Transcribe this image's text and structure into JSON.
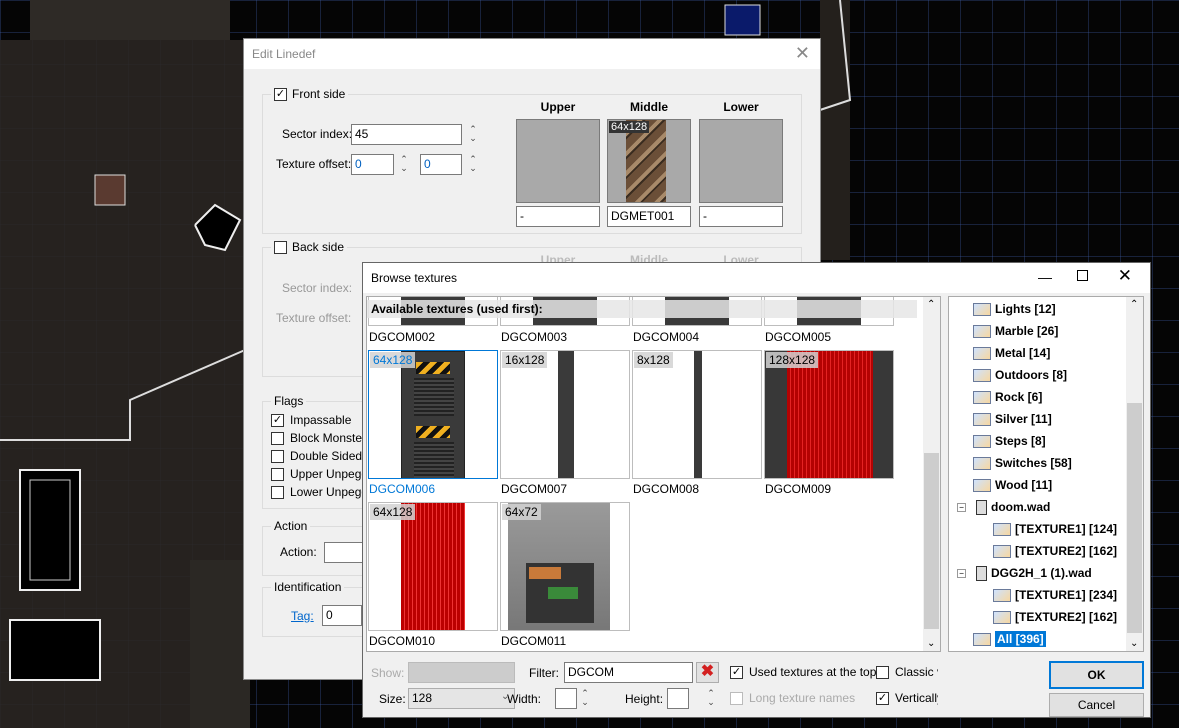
{
  "edit_linedef": {
    "title": "Edit Linedef",
    "front": {
      "label": "Front side",
      "checked": true,
      "sector_label": "Sector index:",
      "sector": "45",
      "offset_label": "Texture offset:",
      "offset_x": "0",
      "offset_y": "0",
      "upper": "Upper",
      "middle": "Middle",
      "lower": "Lower",
      "upper_tex": "-",
      "middle_tex": "DGMET001",
      "lower_tex": "-",
      "middle_size": "64x128"
    },
    "back": {
      "label": "Back side",
      "checked": false,
      "upper": "Upper",
      "middle": "Middle",
      "lower": "Lower",
      "sector_label": "Sector index:",
      "offset_label": "Texture offset:"
    },
    "flags": {
      "label": "Flags",
      "items": [
        {
          "label": "Impassable",
          "checked": true
        },
        {
          "label": "Block Monsters",
          "checked": false
        },
        {
          "label": "Double Sided",
          "checked": false
        },
        {
          "label": "Upper Unpegge",
          "checked": false
        },
        {
          "label": "Lower Unpegge",
          "checked": false
        }
      ]
    },
    "action": {
      "group": "Action",
      "label": "Action:",
      "value": ""
    },
    "identification": {
      "group": "Identification",
      "tag_label": "Tag:",
      "tag": "0"
    }
  },
  "browse": {
    "title": "Browse textures",
    "section_header": "Available textures (used first):",
    "top_row": [
      "DGCOM002",
      "DGCOM003",
      "DGCOM004",
      "DGCOM005"
    ],
    "textures": [
      {
        "name": "DGCOM006",
        "size": "64x128",
        "selected": true
      },
      {
        "name": "DGCOM007",
        "size": "16x128"
      },
      {
        "name": "DGCOM008",
        "size": "8x128"
      },
      {
        "name": "DGCOM009",
        "size": "128x128"
      },
      {
        "name": "DGCOM010",
        "size": "64x128"
      },
      {
        "name": "DGCOM011",
        "size": "64x72"
      }
    ],
    "tree": [
      {
        "label": "Lights [12]",
        "level": 1
      },
      {
        "label": "Marble [26]",
        "level": 1
      },
      {
        "label": "Metal [14]",
        "level": 1
      },
      {
        "label": "Outdoors [8]",
        "level": 1
      },
      {
        "label": "Rock [6]",
        "level": 1
      },
      {
        "label": "Silver [11]",
        "level": 1
      },
      {
        "label": "Steps [8]",
        "level": 1
      },
      {
        "label": "Switches [58]",
        "level": 1
      },
      {
        "label": "Wood [11]",
        "level": 1
      },
      {
        "label": "doom.wad",
        "level": 0,
        "wad": true
      },
      {
        "label": "[TEXTURE1] [124]",
        "level": 2
      },
      {
        "label": "[TEXTURE2] [162]",
        "level": 2
      },
      {
        "label": "DGG2H_1 (1).wad",
        "level": 0,
        "wad": true
      },
      {
        "label": "[TEXTURE1] [234]",
        "level": 2
      },
      {
        "label": "[TEXTURE2] [162]",
        "level": 2
      },
      {
        "label": "All [396]",
        "level": 1,
        "selected": true
      }
    ],
    "show_label": "Show:",
    "show_value": "",
    "size_label": "Size:",
    "size_value": "128",
    "filter_label": "Filter:",
    "filter_value": "DGCOM",
    "width_label": "Width:",
    "width_value": "",
    "height_label": "Height:",
    "height_value": "",
    "used_top": {
      "label": "Used textures at the top",
      "checked": true
    },
    "long_names": {
      "label": "Long texture names",
      "checked": false
    },
    "classic": {
      "label": "Classic vi",
      "checked": false
    },
    "vertically": {
      "label": "Vertically",
      "checked": true
    },
    "ok": "OK",
    "cancel": "Cancel"
  },
  "colors": {
    "accent": "#0078d7",
    "selection": "#0078d7",
    "clear_filter": "#d32020"
  }
}
